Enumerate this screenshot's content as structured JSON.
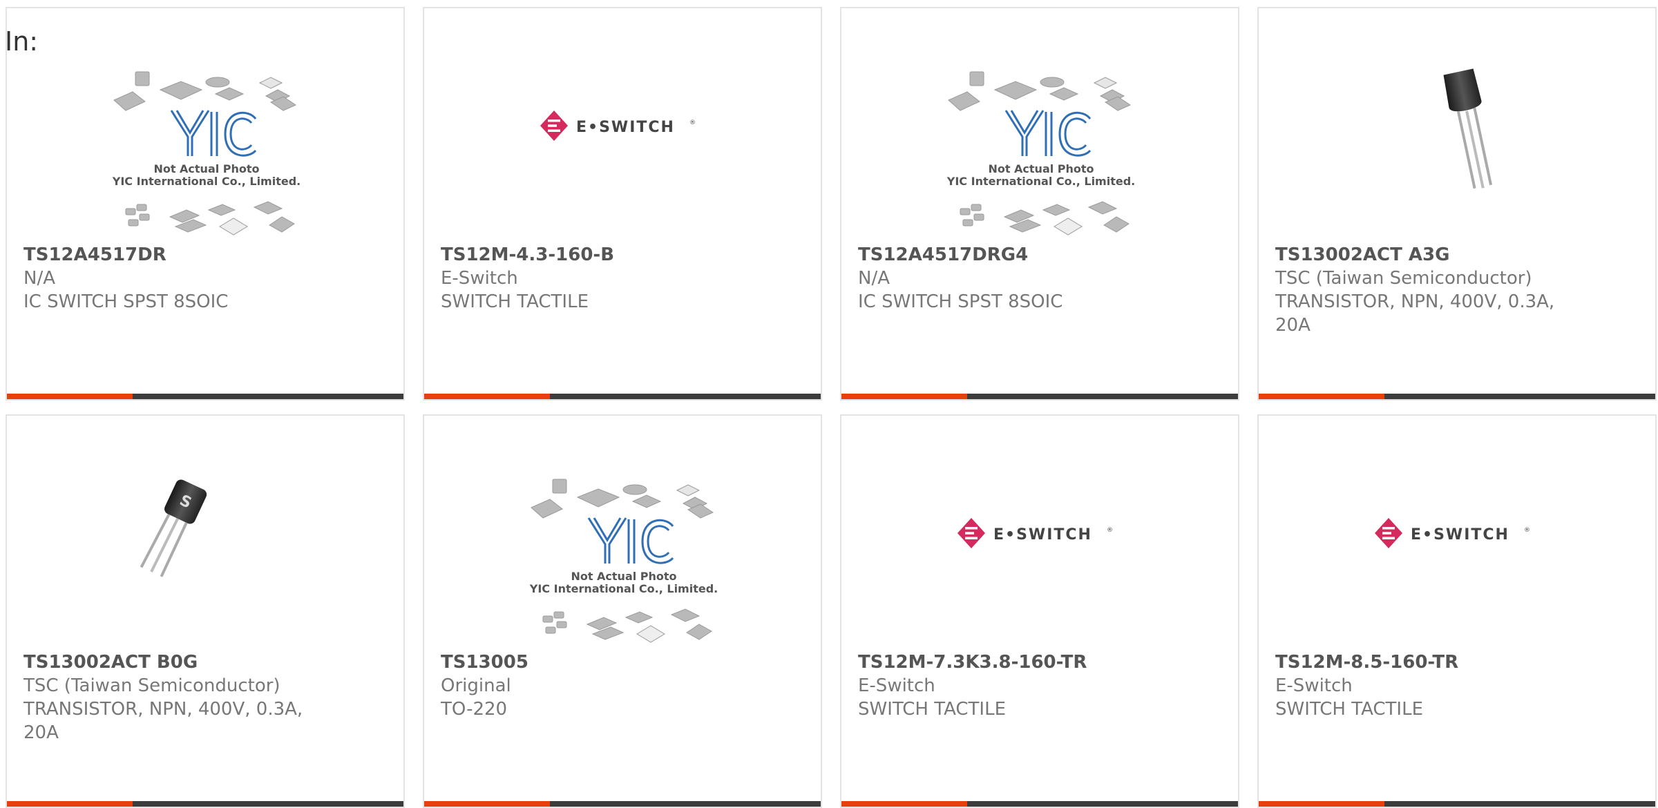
{
  "filter_label": "In:",
  "colors": {
    "accent": "#e8400c",
    "bar": "#3c3c3c",
    "part_number": "#555555",
    "text": "#777777",
    "yic_logo": "#2f6fb5",
    "eswitch": "#d42a5e"
  },
  "placeholder_logo": {
    "brand": "YIC",
    "caption1": "Not Actual Photo",
    "caption2": "YIC International Co., Limited."
  },
  "eswitch_logo": {
    "text": "E•SWITCH",
    "reg": "®"
  },
  "products": [
    {
      "image": "yic-placeholder",
      "part_number": "TS12A4517DR",
      "manufacturer": "N/A",
      "desc1": "IC SWITCH SPST 8SOIC",
      "desc2": ""
    },
    {
      "image": "eswitch-logo",
      "part_number": "TS12M-4.3-160-B",
      "manufacturer": "E-Switch",
      "desc1": "SWITCH TACTILE",
      "desc2": ""
    },
    {
      "image": "yic-placeholder",
      "part_number": "TS12A4517DRG4",
      "manufacturer": "N/A",
      "desc1": "IC SWITCH SPST 8SOIC",
      "desc2": ""
    },
    {
      "image": "to92-transistor",
      "part_number": "TS13002ACT A3G",
      "manufacturer": "TSC (Taiwan Semiconductor)",
      "desc1": "TRANSISTOR, NPN, 400V, 0.3A,",
      "desc2": "20A"
    },
    {
      "image": "to92-tsc-transistor",
      "part_number": "TS13002ACT B0G",
      "manufacturer": "TSC (Taiwan Semiconductor)",
      "desc1": "TRANSISTOR, NPN, 400V, 0.3A,",
      "desc2": "20A"
    },
    {
      "image": "yic-placeholder",
      "part_number": "TS13005",
      "manufacturer": "Original",
      "desc1": "TO-220",
      "desc2": ""
    },
    {
      "image": "eswitch-logo",
      "part_number": "TS12M-7.3K3.8-160-TR",
      "manufacturer": "E-Switch",
      "desc1": "SWITCH TACTILE",
      "desc2": ""
    },
    {
      "image": "eswitch-logo",
      "part_number": "TS12M-8.5-160-TR",
      "manufacturer": "E-Switch",
      "desc1": "SWITCH TACTILE",
      "desc2": ""
    }
  ]
}
